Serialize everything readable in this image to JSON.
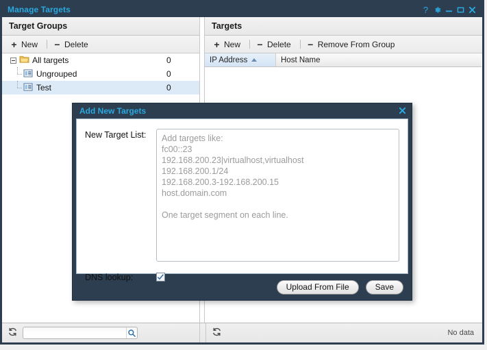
{
  "window": {
    "title": "Manage Targets",
    "controls": [
      {
        "name": "help-icon",
        "glyph": "?"
      },
      {
        "name": "gear-icon",
        "glyph": "gear"
      },
      {
        "name": "minimize-icon",
        "glyph": "minimize"
      },
      {
        "name": "maximize-icon",
        "glyph": "maximize"
      },
      {
        "name": "close-icon",
        "glyph": "close"
      }
    ]
  },
  "left_panel": {
    "header": "Target Groups",
    "toolbar": [
      {
        "name": "new",
        "label": "New",
        "icon": "plus-icon"
      },
      {
        "name": "delete",
        "label": "Delete",
        "icon": "minus-icon"
      }
    ],
    "tree": [
      {
        "label": "All targets",
        "count": "0",
        "icon": "folder-icon",
        "level": 0,
        "selected": false,
        "expanded": true
      },
      {
        "label": "Ungrouped",
        "count": "0",
        "icon": "document-icon",
        "level": 1,
        "selected": false
      },
      {
        "label": "Test",
        "count": "0",
        "icon": "document-icon",
        "level": 1,
        "selected": true
      }
    ],
    "status": {
      "search_value": "",
      "search_placeholder": ""
    }
  },
  "right_panel": {
    "header": "Targets",
    "toolbar": [
      {
        "name": "new",
        "label": "New",
        "icon": "plus-icon"
      },
      {
        "name": "delete",
        "label": "Delete",
        "icon": "minus-icon"
      },
      {
        "name": "remove-from-group",
        "label": "Remove From Group",
        "icon": "minus-icon"
      }
    ],
    "columns": [
      {
        "label": "IP Address",
        "sorted": "asc"
      },
      {
        "label": "Host Name",
        "sorted": "none"
      }
    ],
    "rows": [],
    "status": {
      "text": "No data"
    }
  },
  "dialog": {
    "title": "Add New Targets",
    "close_label": "✖",
    "target_list": {
      "label": "New Target List:",
      "value": "",
      "placeholder": "Add targets like:\nfc00::23\n192.168.200.23|virtualhost,virtualhost\n192.168.200.1/24\n192.168.200.3-192.168.200.15\nhost.domain.com\n\nOne target segment on each line."
    },
    "dns_lookup": {
      "label": "DNS lookup:",
      "checked": true
    },
    "buttons": [
      {
        "name": "upload-from-file",
        "label": "Upload From File"
      },
      {
        "name": "save",
        "label": "Save"
      }
    ]
  },
  "colors": {
    "chrome": "#2c3e50",
    "accent": "#2aa8e0",
    "selection": "#dce9f7",
    "sort_header": "#d4e4f5"
  }
}
